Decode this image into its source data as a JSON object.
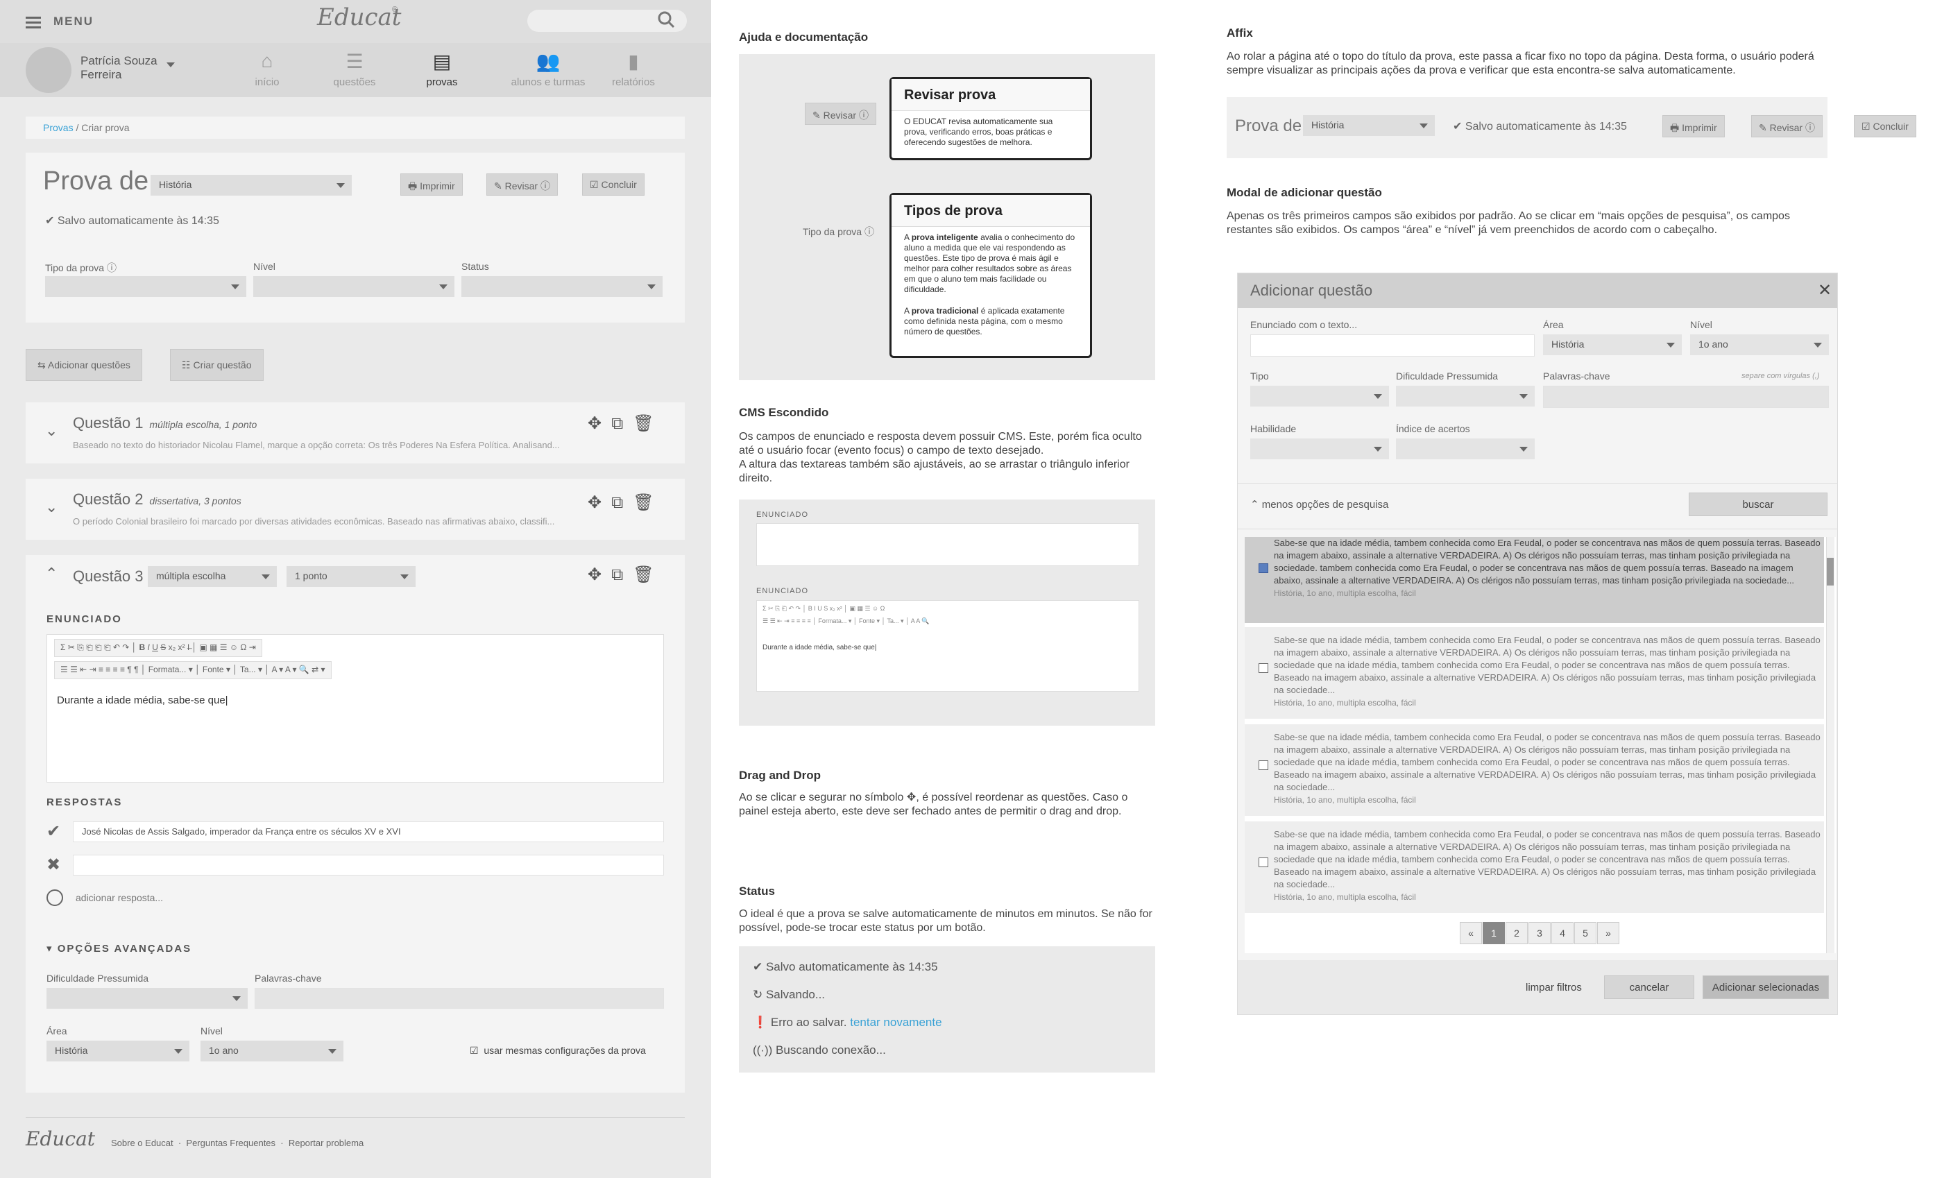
{
  "app": {
    "menu_label": "MENU",
    "logo": "Educat"
  },
  "user": {
    "name_line1": "Patrícia Souza",
    "name_line2": "Ferreira"
  },
  "nav": [
    {
      "icon": "home-icon",
      "label": "início"
    },
    {
      "icon": "list-icon",
      "label": "questões"
    },
    {
      "icon": "document-icon",
      "label": "provas"
    },
    {
      "icon": "users-icon",
      "label": "alunos e turmas"
    },
    {
      "icon": "bar-chart-icon",
      "label": "relatórios"
    }
  ],
  "breadcrumb": {
    "link": "Provas",
    "sep": "/",
    "current": "Criar prova"
  },
  "prova": {
    "title": "Prova de",
    "subject": "História",
    "print": "Imprimir",
    "review": "Revisar",
    "finish": "Concluir",
    "saved": "Salvo automaticamente às 14:35",
    "type_label": "Tipo da prova",
    "level_label": "Nível",
    "status_label": "Status"
  },
  "actions": {
    "add_questions": "Adicionar questões",
    "create_question": "Criar questão"
  },
  "questions": [
    {
      "title": "Questão 1",
      "meta": "múltipla escolha, 1 ponto",
      "desc": "Baseado no texto do historiador Nicolau Flamel, marque a opção correta: Os três Poderes Na Esfera Política. Analisand..."
    },
    {
      "title": "Questão 2",
      "meta": "dissertativa, 3 pontos",
      "desc": "O período Colonial brasileiro foi marcado por diversas atividades econômicas. Baseado nas afirmativas abaixo, classifi..."
    }
  ],
  "q3": {
    "title": "Questão 3",
    "type": "múltipla escolha",
    "points": "1 ponto",
    "statement_label": "ENUNCIADO",
    "toolbar_format": "Formata...",
    "toolbar_font": "Fonte",
    "toolbar_size": "Ta...",
    "text": "Durante a idade média, sabe-se que|",
    "answers_label": "RESPOSTAS",
    "answer1": "José Nicolas de Assis Salgado, imperador da França entre os séculos XV e XVI",
    "add_answer": "adicionar resposta...",
    "advanced": "OPÇÕES AVANÇADAS",
    "difficulty": "Dificuldade Pressumida",
    "keywords": "Palavras-chave",
    "area": "Área",
    "area_val": "História",
    "level": "Nível",
    "level_val": "1o ano",
    "same_config": "usar mesmas configurações da prova"
  },
  "footer": {
    "logo": "Educat",
    "links": [
      "Sobre o Educat",
      "Perguntas Frequentes",
      "Reportar problema"
    ]
  },
  "help": {
    "title": "Ajuda e documentação",
    "review_btn": "Revisar",
    "tip1_title": "Revisar prova",
    "tip1_text": "O EDUCAT revisa automaticamente sua prova, verificando erros, boas práticas e oferecendo sugestões de melhora.",
    "type_label": "Tipo da prova",
    "tip2_title": "Tipos de prova",
    "tip2_bold1": "prova inteligente",
    "tip2_text1a": "A",
    "tip2_text1b": "avalia o conhecimento do aluno a medida que ele vai respondendo as questões. Este tipo de prova é mais ágil e melhor para colher resultados sobre as áreas em que o aluno tem mais facilidade ou dificuldade.",
    "tip2_bold2": "prova tradicional",
    "tip2_text2a": "A",
    "tip2_text2b": "é aplicada exatamente como definida nesta página, com o mesmo número de questões."
  },
  "cms": {
    "title": "CMS Escondido",
    "text1": "Os campos de enunciado e resposta devem possuir CMS. Este, porém fica oculto até o usuário focar (evento focus) o campo de texto desejado.",
    "text2": "A altura das textareas também são ajustáveis, ao se arrastar o triângulo inferior direito.",
    "label": "ENUNCIADO",
    "sample": "Durante a idade média, sabe-se que|",
    "fmt": "Formata...",
    "font": "Fonte",
    "size": "Ta..."
  },
  "dnd": {
    "title": "Drag and Drop",
    "text_a": "Ao se clicar e segurar no símbolo",
    "text_b": ", é possível reordenar as questões.",
    "text2": "Caso o painel esteja aberto, este deve ser fechado antes de permitir o drag and drop."
  },
  "status": {
    "title": "Status",
    "text": "O ideal é que a prova se salve automaticamente de minutos em minutos. Se não for possível, pode-se trocar este status por um botão.",
    "saved": "Salvo automaticamente às 14:35",
    "saving": "Salvando...",
    "error": "Erro ao salvar.",
    "retry": "tentar novamente",
    "searching": "Buscando conexão..."
  },
  "affix": {
    "title": "Affix",
    "text": "Ao rolar a página até o topo do título da prova, este passa a ficar fixo no topo da página. Desta forma, o usuário poderá sempre visualizar as principais ações da prova e verificar que esta encontra-se salva automaticamente.",
    "prova": "Prova de",
    "subject": "História",
    "saved": "Salvo automaticamente às 14:35",
    "print": "Imprimir",
    "review": "Revisar",
    "finish": "Concluir"
  },
  "modal_doc": {
    "title": "Modal de adicionar questão",
    "text": "Apenas os três primeiros campos são exibidos por padrão. Ao se clicar em “mais opções de pesquisa”, os campos restantes são exibidos. Os campos “área” e “nível” já vem preenchidos de acordo com o cabeçalho."
  },
  "modal": {
    "title": "Adicionar questão",
    "search_placeholder": "Enunciado com o texto...",
    "area": "Área",
    "area_val": "História",
    "level": "Nível",
    "level_val": "1o ano",
    "type": "Tipo",
    "difficulty": "Dificuldade Pressumida",
    "keywords": "Palavras-chave",
    "keywords_hint": "separe com vírgulas (,)",
    "skill": "Habilidade",
    "hit_index": "Índice de acertos",
    "less_options": "menos opções de pesquisa",
    "search_btn": "buscar",
    "results": [
      {
        "text": "Sabe-se que na idade média, tambem conhecida como Era Feudal, o poder se concentrava nas mãos de quem possuía terras. Baseado na imagem abaixo, assinale a alternative VERDADEIRA. A) Os clérigos não possuíam terras, mas tinham posição privilegiada na sociedade. tambem conhecida como Era Feudal, o poder se concentrava nas mãos de quem possuía terras. Baseado na imagem abaixo, assinale a alternative VERDADEIRA. A) Os clérigos não possuíam terras, mas tinham posição privilegiada na sociedade...",
        "meta": "História, 1o ano, multipla escolha, fácil",
        "checked": true
      },
      {
        "text": "Sabe-se que na idade média, tambem conhecida como Era Feudal, o poder se concentrava nas mãos de quem possuía terras. Baseado na imagem abaixo, assinale a alternative VERDADEIRA. A) Os clérigos não possuíam terras, mas tinham posição privilegiada na sociedade que na idade média, tambem conhecida como Era Feudal, o poder se concentrava nas mãos de quem possuía terras. Baseado na imagem abaixo, assinale a alternative VERDADEIRA. A) Os clérigos não possuíam terras, mas tinham posição privilegiada na sociedade...",
        "meta": "História, 1o ano, multipla escolha, fácil",
        "checked": false
      },
      {
        "text": "Sabe-se que na idade média, tambem conhecida como Era Feudal, o poder se concentrava nas mãos de quem possuía terras. Baseado na imagem abaixo, assinale a alternative VERDADEIRA. A) Os clérigos não possuíam terras, mas tinham posição privilegiada na sociedade que na idade média, tambem conhecida como Era Feudal, o poder se concentrava nas mãos de quem possuía terras. Baseado na imagem abaixo, assinale a alternative VERDADEIRA. A) Os clérigos não possuíam terras, mas tinham posição privilegiada na sociedade...",
        "meta": "História, 1o ano, multipla escolha, fácil",
        "checked": false
      },
      {
        "text": "Sabe-se que na idade média, tambem conhecida como Era Feudal, o poder se concentrava nas mãos de quem possuía terras. Baseado na imagem abaixo, assinale a alternative VERDADEIRA. A) Os clérigos não possuíam terras, mas tinham posição privilegiada na sociedade que na idade média, tambem conhecida como Era Feudal, o poder se concentrava nas mãos de quem possuía terras. Baseado na imagem abaixo, assinale a alternative VERDADEIRA. A) Os clérigos não possuíam terras, mas tinham posição privilegiada na sociedade...",
        "meta": "História, 1o ano, multipla escolha, fácil",
        "checked": false
      }
    ],
    "pages": [
      "«",
      "1",
      "2",
      "3",
      "4",
      "5",
      "»"
    ],
    "clear": "limpar filtros",
    "cancel": "cancelar",
    "add_selected": "Adicionar selecionadas"
  }
}
